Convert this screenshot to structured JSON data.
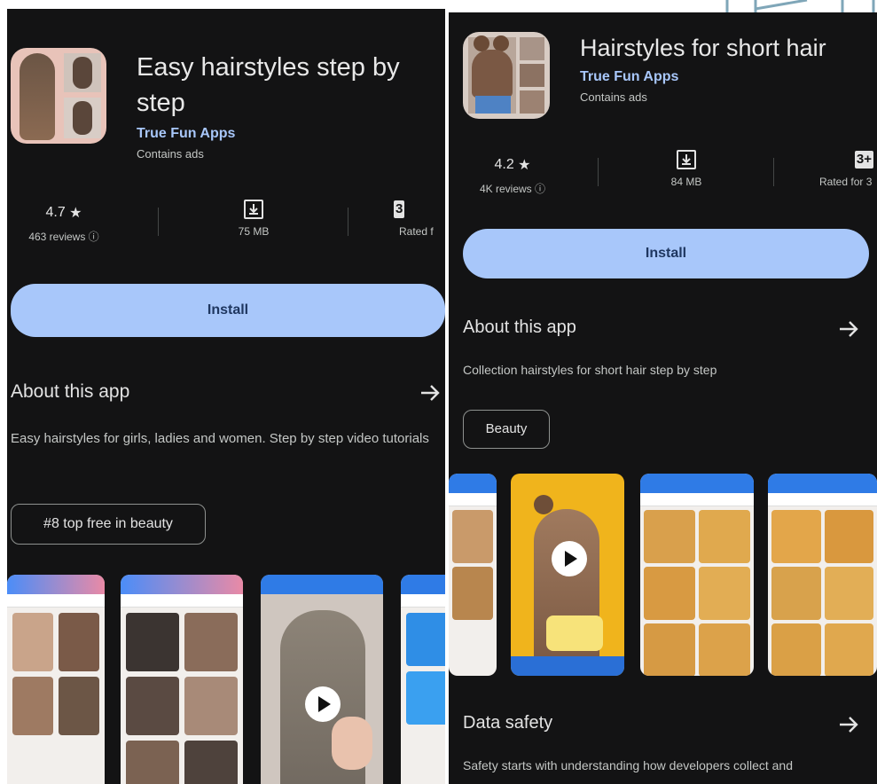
{
  "left": {
    "app": {
      "title": "Easy hairstyles step by step",
      "developer": "True Fun Apps",
      "ads_note": "Contains ads"
    },
    "stats": {
      "rating": "4.7",
      "star": "★",
      "reviews": "463 reviews ⓘ",
      "size": "75 MB",
      "content_rating_badge": "3",
      "content_rating_label": "Rated f"
    },
    "install_label": "Install",
    "about": {
      "title": "About this app",
      "description": "Easy hairstyles for girls, ladies and women. Step by step video tutorials",
      "chip": "#8 top free in beauty"
    }
  },
  "right": {
    "app": {
      "title": "Hairstyles for short hair",
      "developer": "True Fun Apps",
      "ads_note": "Contains ads"
    },
    "stats": {
      "rating": "4.2",
      "star": "★",
      "reviews": "4K reviews ⓘ",
      "size": "84 MB",
      "content_rating_badge": "3+",
      "content_rating_label": "Rated for 3"
    },
    "install_label": "Install",
    "about": {
      "title": "About this app",
      "description": "Collection hairstyles for short hair step by step",
      "chip": "Beauty"
    },
    "safety": {
      "title": "Data safety",
      "description": "Safety starts with understanding how developers collect and"
    }
  },
  "icons": [
    "star-icon",
    "download-icon",
    "info-icon",
    "arrow-right-icon",
    "play-icon"
  ],
  "colors": {
    "background": "#131314",
    "accent": "#a8c7fa",
    "install_text": "#1f3760"
  }
}
